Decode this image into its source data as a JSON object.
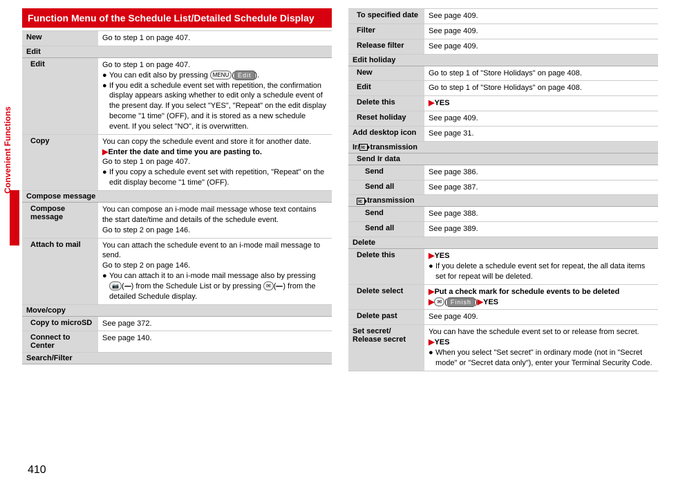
{
  "side_label": "Convenient Functions",
  "page_number": "410",
  "header": "Function Menu of the Schedule List/Detailed Schedule Display",
  "left": {
    "new": {
      "label": "New",
      "value": "Go to step 1 on page 407."
    },
    "edit_sect": "Edit",
    "edit": {
      "label": "Edit",
      "line1": "Go to step 1 on page 407.",
      "b1": "You can edit also by pressing ",
      "b1_btn_key": "MENU",
      "b1_btn_soft": "Edit",
      "b2": "If you edit a schedule event set with repetition, the confirmation display appears asking whether to edit only a schedule event of the present day. If you select \"YES\", \"Repeat\" on the edit display become \"1 time\" (OFF), and it is stored as a new schedule event. If you select \"NO\", it is overwritten."
    },
    "copy": {
      "label": "Copy",
      "line1": "You can copy the schedule event and store it for another date.",
      "line2": "Enter the date and time you are pasting to.",
      "line3": "Go to step 1 on page 407.",
      "b1": "If you copy a schedule event set with repetition, \"Repeat\" on the edit display become \"1 time\" (OFF)."
    },
    "compose_sect": "Compose message",
    "compose": {
      "label": "Compose message",
      "line1": "You can compose an i-mode mail message whose text contains the start date/time and details of the schedule event.",
      "line2": "Go to step 2 on page 146."
    },
    "attach": {
      "label": "Attach to mail",
      "line1": "You can attach the schedule event to an i-mode mail message to send.",
      "line2": "Go to step 2 on page 146.",
      "b1_pre": "You can attach it to an i-mode mail message also by pressing ",
      "b1_key1": "📷",
      "b1_soft1": " ",
      "b1_mid": " from the Schedule List or by pressing ",
      "b1_key2": "✉",
      "b1_soft2": " ",
      "b1_post": " from the detailed Schedule display."
    },
    "move_sect": "Move/copy",
    "microsd": {
      "label": "Copy to microSD",
      "value": "See page 372."
    },
    "connect": {
      "label": "Connect to Center",
      "value": "See page 140."
    },
    "search_sect": "Search/Filter"
  },
  "right": {
    "tospec": {
      "label": "To specified date",
      "value": "See page 409."
    },
    "filter": {
      "label": "Filter",
      "value": "See page 409."
    },
    "relfilter": {
      "label": "Release filter",
      "value": "See page 409."
    },
    "editholiday_sect": "Edit holiday",
    "eh_new": {
      "label": "New",
      "value": "Go to step 1 of \"Store Holidays\" on page 408."
    },
    "eh_edit": {
      "label": "Edit",
      "value": "Go to step 1 of \"Store Holidays\" on page 408."
    },
    "eh_delthis": {
      "label": "Delete this",
      "value": "YES"
    },
    "eh_reset": {
      "label": "Reset holiday",
      "value": "See page 409."
    },
    "desktop": {
      "label": "Add desktop icon",
      "value": "See page 31."
    },
    "ir_sect": {
      "pre": "Ir/",
      "post": " transmission"
    },
    "sendir_sect": "Send Ir data",
    "ir_send": {
      "label": "Send",
      "value": "See page 386."
    },
    "ir_sendall": {
      "label": "Send all",
      "value": "See page 387."
    },
    "ic_sect": "transmission",
    "ic_send": {
      "label": "Send",
      "value": "See page 388."
    },
    "ic_sendall": {
      "label": "Send all",
      "value": "See page 389."
    },
    "delete_sect": "Delete",
    "del_this": {
      "label": "Delete this",
      "v1": "YES",
      "b1": "If you delete a schedule event set for repeat, the all data items set for repeat will be deleted."
    },
    "del_sel": {
      "label": "Delete select",
      "v1": "Put a check mark for schedule events to be deleted",
      "key": "✉",
      "soft": "Finish",
      "v2": "YES"
    },
    "del_past": {
      "label": "Delete past",
      "value": "See page 409."
    },
    "secret": {
      "label": "Set secret/\nRelease secret",
      "line1": "You can have the schedule event set to or release from secret.",
      "v1": "YES",
      "b1": "When you select \"Set secret\" in ordinary mode (not in \"Secret mode\" or \"Secret data only\"), enter your Terminal Security Code."
    }
  }
}
